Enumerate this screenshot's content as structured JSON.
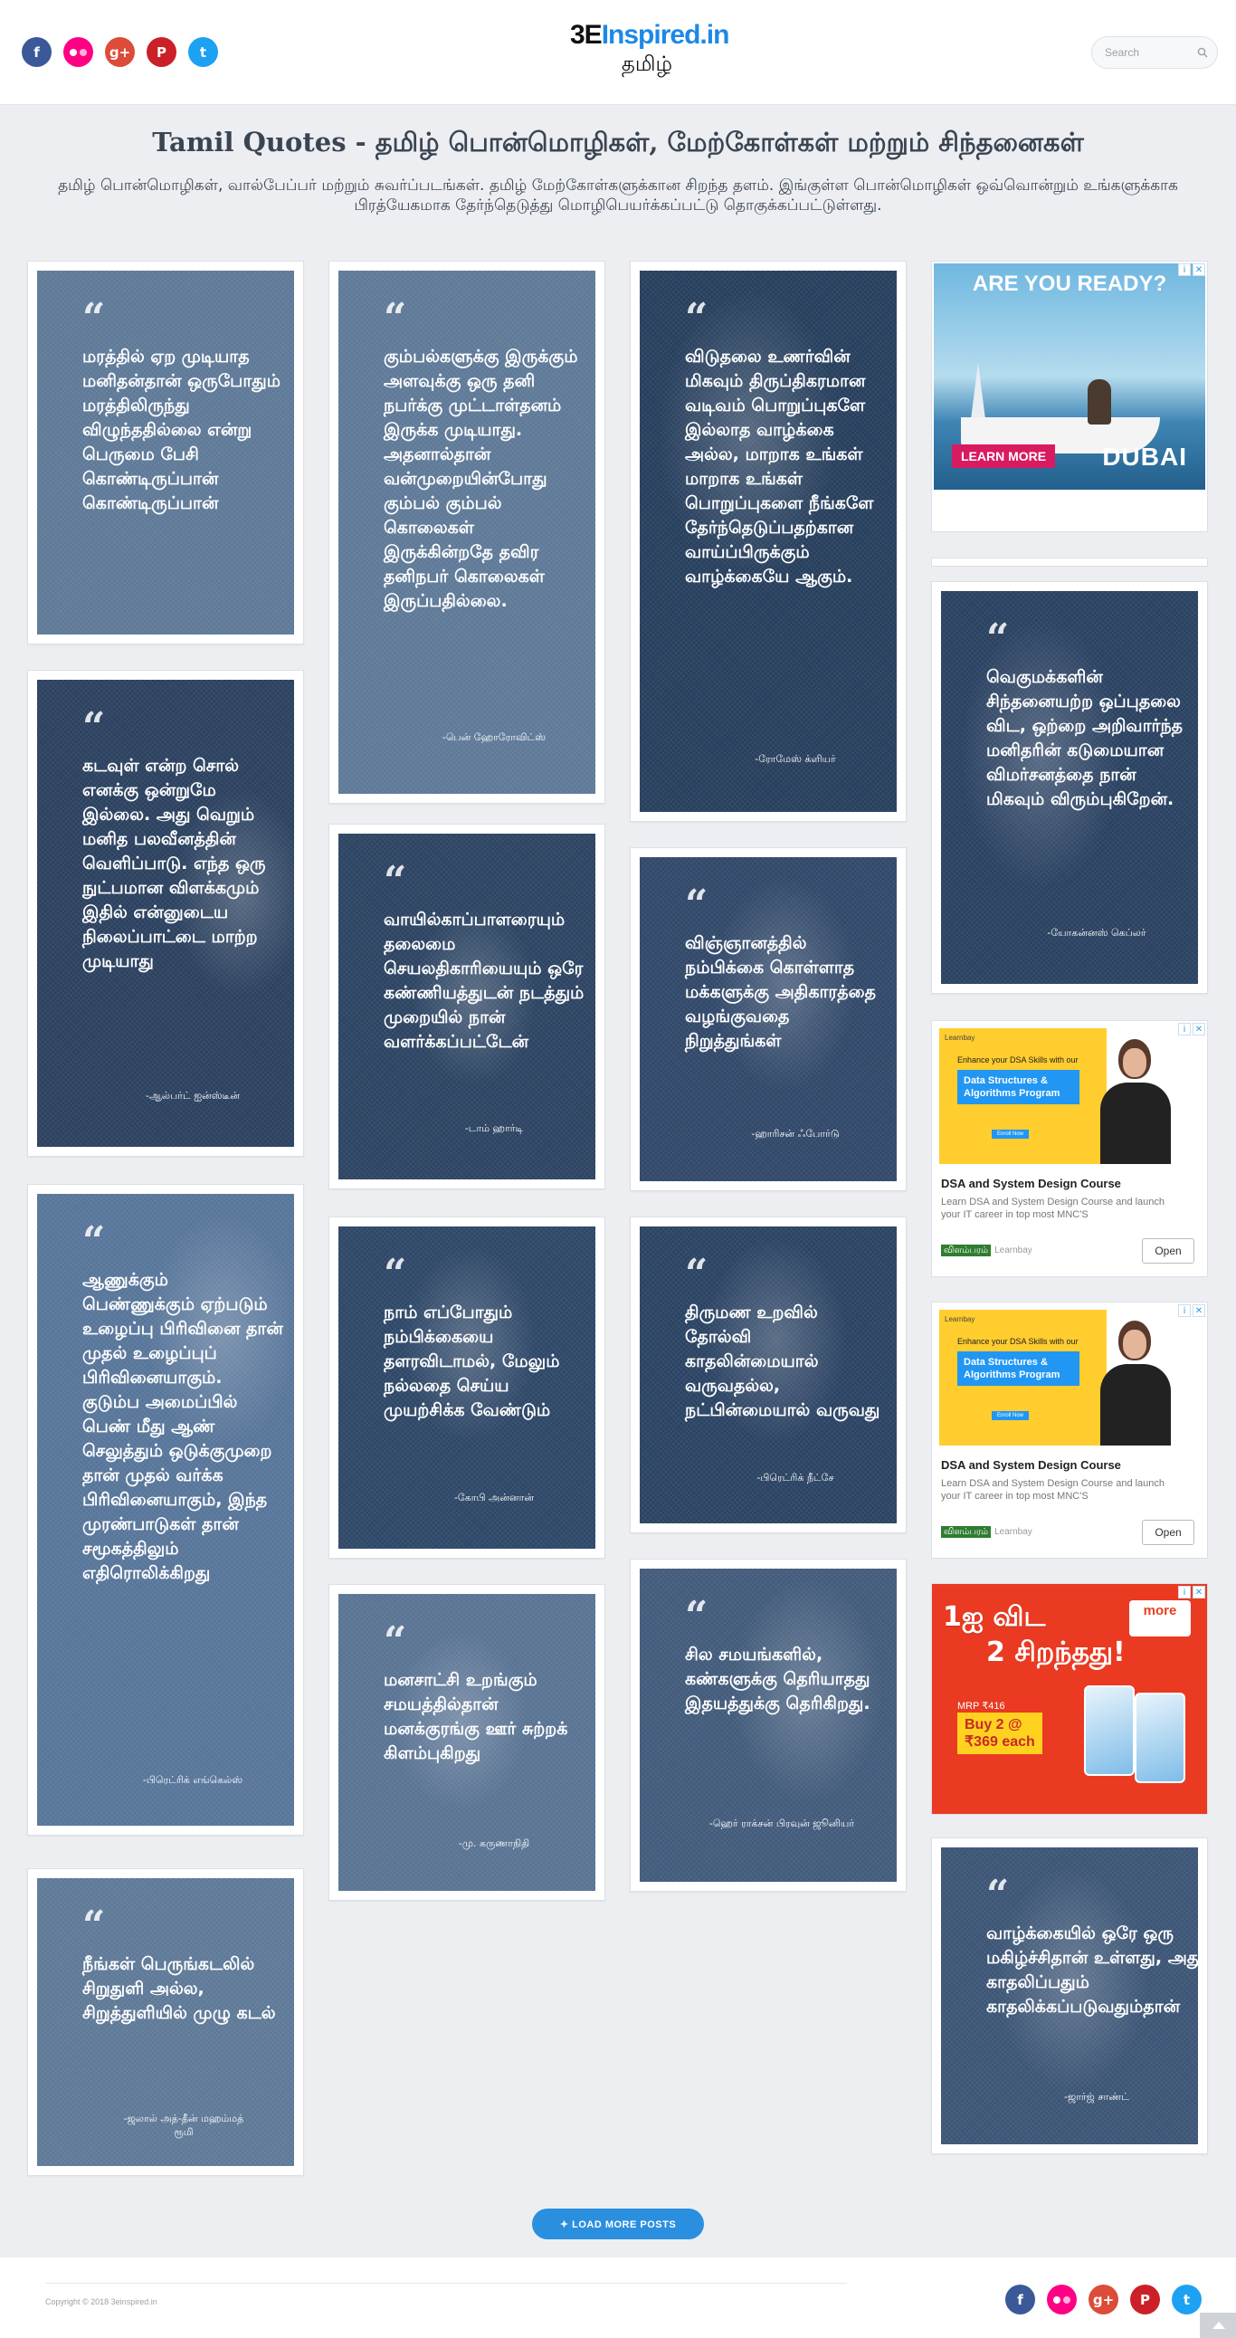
{
  "header": {
    "logo_mark": "3E",
    "logo_text": "Inspired.in",
    "logo_sub": "தமிழ்",
    "search_placeholder": "Search",
    "social": [
      {
        "name": "facebook",
        "glyph": "f",
        "color": "#3b5998"
      },
      {
        "name": "flickr",
        "glyph": "",
        "color": "#ff0084"
      },
      {
        "name": "google-plus",
        "glyph": "g+",
        "color": "#dd4b39"
      },
      {
        "name": "pinterest",
        "glyph": "P",
        "color": "#cb2027"
      },
      {
        "name": "twitter",
        "glyph": "t",
        "color": "#1da1f2"
      }
    ]
  },
  "page": {
    "title": "Tamil Quotes - தமிழ் பொன்மொழிகள், மேற்கோள்கள் மற்றும் சிந்தனைகள்",
    "intro": "தமிழ் பொன்மொழிகள், வால்பேப்பர் மற்றும் சுவர்ப்படங்கள். தமிழ் மேற்கோள்களுக்கான சிறந்த தளம். இங்குள்ள பொன்மொழிகள் ஒவ்வொன்றும் உங்களுக்காக பிரத்யேகமாக தேர்ந்தெடுத்து மொழிபெயர்க்கப்பட்டு தொகுக்கப்பட்டுள்ளது."
  },
  "quotes": [
    {
      "text": "மரத்தில் ஏற முடியாத மனிதன்தான் ஒருபோதும் மரத்திலிருந்து விழுந்ததில்லை என்று பெருமை பேசி கொண்டிருப்பான் கொண்டிருப்பான்",
      "author": "",
      "bg": "#5f7a98"
    },
    {
      "text": "கடவுள் என்ற சொல் எனக்கு ஒன்றுமே இல்லை. அது வெறும் மனித பலவீனத்தின் வெளிப்பாடு. எந்த ஒரு நுட்பமான விளக்கமும் இதில் என்னுடைய நிலைப்பாட்டை மாற்ற முடியாது",
      "author": "-ஆல்பர்ட் ஐன்ஸ்டீன்",
      "bg": "#2c4260"
    },
    {
      "text": "ஆணுக்கும் பெண்ணுக்கும் ஏற்படும் உழைப்பு பிரிவினை தான் முதல் உழைப்புப் பிரிவினையாகும். குடும்ப அமைப்பில் பெண் மீது ஆண் செலுத்தும் ஒடுக்குமுறை தான் முதல் வர்க்க பிரிவினையாகும், இந்த முரண்பாடுகள் தான் சமூகத்திலும் எதிரொலிக்கிறது",
      "author": "-பிரெட்ரிக் எங்கெல்ஸ்",
      "bg": "#58769a"
    },
    {
      "text": "நீங்கள் பெருங்கடலில் சிறுதுளி அல்ல, சிறுத்துளியில் முழு கடல்",
      "author": "-ஜலால் அத்-தீன் மஹம்மத் ரூமி",
      "bg": "#5f7a98"
    },
    {
      "text": "கும்பல்களுக்கு இருக்கும் அளவுக்கு ஒரு தனி நபர்க்கு முட்டாள்தனம் இருக்க முடியாது. அதனால்தான் வன்முறையின்போது கும்பல் கும்பல் கொலைகள் இருக்கின்றதே தவிர தனிநபர் கொலைகள் இருப்பதில்லை.",
      "author": "-பென் ஹோரோவிட்ஸ்",
      "bg": "#5f7a98"
    },
    {
      "text": "வாயில்காப்பாளரையும் தலைமை செயலதிகாரியையும் ஒரே கண்ணியத்துடன் நடத்தும் முறையில் நான் வளர்க்கப்பட்டேன்",
      "author": "-டாம் ஹார்டி",
      "bg": "#2d4563"
    },
    {
      "text": "நாம் எப்போதும் நம்பிக்கையை தளரவிடாமல், மேலும் நல்லதை செய்ய முயற்சிக்க வேண்டும்",
      "author": "-கோபி அன்னான்",
      "bg": "#2f4868"
    },
    {
      "text": "மனசாட்சி உறங்கும் சமயத்தில்தான் மனக்குரங்கு ஊர் சுற்றக் கிளம்புகிறது",
      "author": "-மு. கருணாநிதி",
      "bg": "#5a7494"
    },
    {
      "text": "விடுதலை உணர்வின் மிகவும் திருப்திகரமான வடிவம் பொறுப்புகளே இல்லாத வாழ்க்கை அல்ல, மாறாக உங்கள் மாறாக உங்கள் பொறுப்புகளை நீங்களே தேர்ந்தெடுப்பதற்கான வாய்ப்பிருக்கும் வாழ்க்கையே ஆகும்.",
      "author": "-ரோமேஸ் க்ளியர்",
      "bg": "#28405e"
    },
    {
      "text": "விஞ்ஞானத்தில் நம்பிக்கை கொள்ளாத மக்களுக்கு அதிகாரத்தை வழங்குவதை நிறுத்துங்கள்",
      "author": "-ஹாரிசன் ஃபோர்டு",
      "bg": "#32496a"
    },
    {
      "text": "திருமண உறவில் தோல்வி காதலின்மையால் வருவதல்ல, நட்பின்மையால் வருவது",
      "author": "-பிரெட்ரிக் நீட்சே",
      "bg": "#2c4464"
    },
    {
      "text": "சில சமயங்களில், கண்களுக்கு தெரியாதது இதயத்துக்கு தெரிகிறது.",
      "author": "-ஹெர் ராக்சன் பிரவுன் ஜூனியர்",
      "bg": "#435c7c"
    },
    {
      "text": "வெகுமக்களின் சிந்தனையற்ற ஒப்புதலை விட, ஒற்றை அறிவார்ந்த மனிதரின் கடுமையான விமர்சனத்தை நான் மிகவும் விரும்புகிறேன்.",
      "author": "-யோகன்னஸ் கெப்லர்",
      "bg": "#2b4262"
    },
    {
      "text": "வாழ்க்கையில் ஒரே ஒரு மகிழ்ச்சிதான் உள்ளது, அது காதலிப்பதும் காதலிக்கப்படுவதும்தான்",
      "author": "-ஜார்ஜ் சாண்ட்",
      "bg": "#3d5676"
    }
  ],
  "ads": {
    "dubai": {
      "title": "ARE YOU READY?",
      "button": "LEARN MORE",
      "brand": "DUBAI"
    },
    "course": {
      "chip": "Learnbay",
      "small": "Enhance your DSA Skills with our",
      "box": "Data Structures & Algorithms Program",
      "enroll": "Enroll Now",
      "title": "DSA and System Design Course",
      "desc": "Learn DSA and System Design Course and launch your IT career in top most MNC'S",
      "badge": "விளம்பரம்",
      "advertiser": "Learnbay",
      "open": "Open"
    },
    "promo": {
      "line1": "1ஐ விட",
      "line2": "2 சிறந்தது!",
      "logo": "more",
      "mrp": "MRP ₹416",
      "price_line1": "Buy 2 @",
      "price_line2": "₹369 each"
    }
  },
  "load_more": "✦ LOAD MORE POSTS",
  "footer": {
    "copyright": "Copyright © 2018 3einspired.in"
  }
}
